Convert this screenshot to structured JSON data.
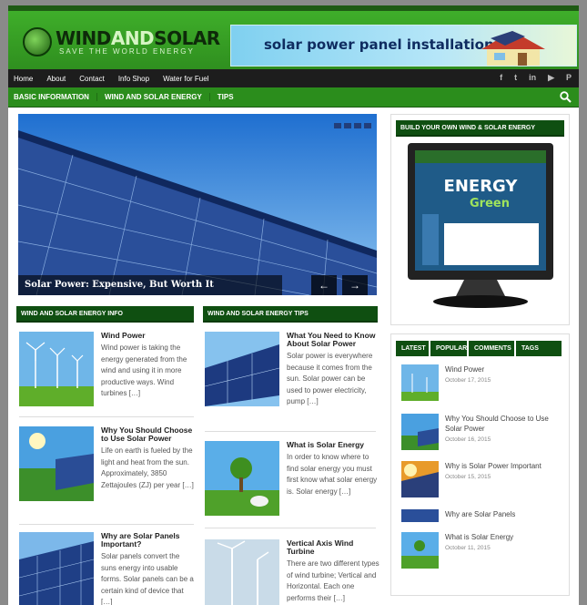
{
  "header": {
    "logo_wind": "WIND",
    "logo_and": "AND",
    "logo_solar": "SOLAR",
    "logo_tagline": "SAVE THE WORLD ENERGY",
    "banner_text": "solar power panel installation"
  },
  "topnav": {
    "items": [
      "Home",
      "About",
      "Contact",
      "Info Shop",
      "Water for Fuel"
    ],
    "social_icons": [
      "facebook-icon",
      "twitter-icon",
      "linkedin-icon",
      "youtube-icon",
      "pinterest-icon"
    ],
    "social_glyphs": [
      "f",
      "t",
      "in",
      "▶",
      "P"
    ]
  },
  "catnav": {
    "items": [
      "BASIC INFORMATION",
      "WIND AND SOLAR ENERGY",
      "TIPS"
    ]
  },
  "slider": {
    "caption": "Solar Power: Expensive, But Worth It",
    "prev": "←",
    "next": "→"
  },
  "sections": {
    "left_title": "WIND AND SOLAR ENERGY INFO",
    "right_title": "WIND AND SOLAR ENERGY TIPS"
  },
  "left_posts": [
    {
      "title": "Wind Power",
      "excerpt": "Wind power is taking the energy generated from the wind and using it in more productive ways. Wind turbines […]"
    },
    {
      "title": "Why You Should Choose to Use Solar Power",
      "excerpt": "Life on earth is fueled by the light and heat from the sun. Approximately, 3850 Zettajoules (ZJ) per year […]"
    },
    {
      "title": "Why are Solar Panels Important?",
      "excerpt": "Solar panels convert the suns energy into usable forms. Solar panels can be a certain kind of device that […]"
    }
  ],
  "right_posts": [
    {
      "title": "What You Need to Know About Solar Power",
      "excerpt": "Solar power is everywhere because it comes from the sun. Solar power can be used to power electricity, pump […]"
    },
    {
      "title": "What is Solar Energy",
      "excerpt": "In order to know where to find solar energy you must first know what solar energy is. Solar energy […]"
    },
    {
      "title": "Vertical Axis Wind Turbine",
      "excerpt": "There are two different types of wind turbine; Vertical and Horizontal. Each one performs their […]"
    }
  ],
  "sidebar": {
    "widget_title": "BUILD YOUR OWN WIND & SOLAR ENERGY",
    "monitor_headline": "ENERGY",
    "monitor_sub": "Green",
    "tabs": [
      "LATEST",
      "POPULAR",
      "COMMENTS",
      "TAGS"
    ],
    "items": [
      {
        "title": "Wind Power",
        "date": "October 17, 2015"
      },
      {
        "title": "Why You Should Choose to Use Solar Power",
        "date": "October 16, 2015"
      },
      {
        "title": "Why is Solar Power Important",
        "date": "October 15, 2015"
      },
      {
        "title": "Why are Solar Panels",
        "date": ""
      },
      {
        "title": "What is Solar Energy",
        "date": "October 11, 2015"
      }
    ]
  }
}
